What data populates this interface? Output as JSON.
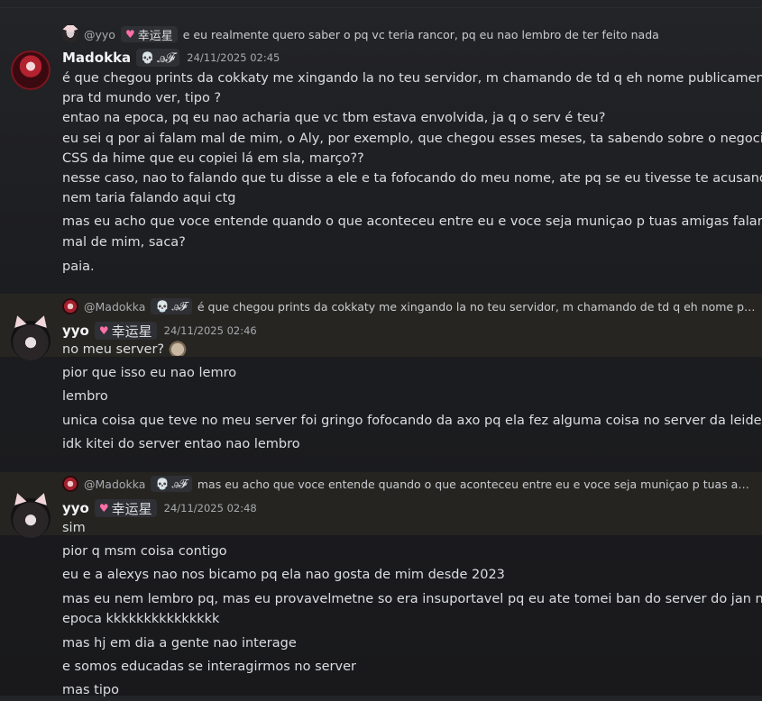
{
  "colors": {
    "background": "#1c1d20",
    "highlight": "#3a3428",
    "username": "#f2f3f5",
    "text": "#dbdee1",
    "timestamp": "#a6a9ae"
  },
  "messages": [
    {
      "reply": {
        "author": "@yyo",
        "tag": "幸运星",
        "text": "e eu realmente quero saber o pq vc teria rancor, pq eu nao lembro de ter feito nada"
      },
      "author": "Madokka",
      "tag": "ꭿ𝓕",
      "timestamp": "24/11/2025 02:45",
      "lines": [
        "é que chegou prints da cokkaty me xingando la no teu servidor, m chamando de td q eh nome publicamente",
        "pra td mundo ver, tipo ?",
        "entao na epoca, pq eu nao acharia que vc tbm estava envolvida, ja q o serv é teu?",
        "eu sei q por ai falam mal de mim, o Aly, por exemplo, que chegou esses meses, ta sabendo sobre o negocio do",
        "CSS da hime que eu copiei lá em sla, março??",
        "nesse caso, nao to falando que tu disse a ele e ta fofocando do meu nome, ate pq se eu tivesse te acusando,",
        "nem taria falando aqui ctg",
        "mas eu acho que voce entende quando o que aconteceu entre eu e voce seja muniçao p tuas amigas falarem",
        "mal de mim, saca?",
        "paia."
      ]
    },
    {
      "reply": {
        "author": "@Madokka",
        "tag": "ꭿ𝓕",
        "text": "é que chegou prints da cokkaty me xingando la no teu servidor, m chamando de td q eh nome pu..."
      },
      "author": "yyo",
      "tag": "幸运星",
      "timestamp": "24/11/2025 02:46",
      "lines": [
        "no meu server?",
        "pior que isso eu nao lemro",
        "lembro",
        "unica coisa que teve no meu server foi gringo fofocando da axo pq ela fez alguma coisa no server da leiden",
        "idk kitei do server entao nao lembro"
      ]
    },
    {
      "reply": {
        "author": "@Madokka",
        "tag": "ꭿ𝓕",
        "text": "mas eu acho que voce entende quando o que aconteceu entre eu e voce seja muniçao p tuas ami..."
      },
      "author": "yyo",
      "tag": "幸运星",
      "timestamp": "24/11/2025 02:48",
      "lines": [
        "sim",
        "pior q msm coisa contigo",
        "eu e a alexys nao nos bicamo pq ela nao gosta de mim desde 2023",
        "mas eu nem lembro pq, mas eu provavelmetne so era insuportavel pq eu ate tomei ban do server do jan na",
        "epoca kkkkkkkkkkkkkkk",
        "mas hj em dia a gente nao interage",
        "e somos educadas se interagirmos no server",
        "mas tipo"
      ]
    }
  ]
}
